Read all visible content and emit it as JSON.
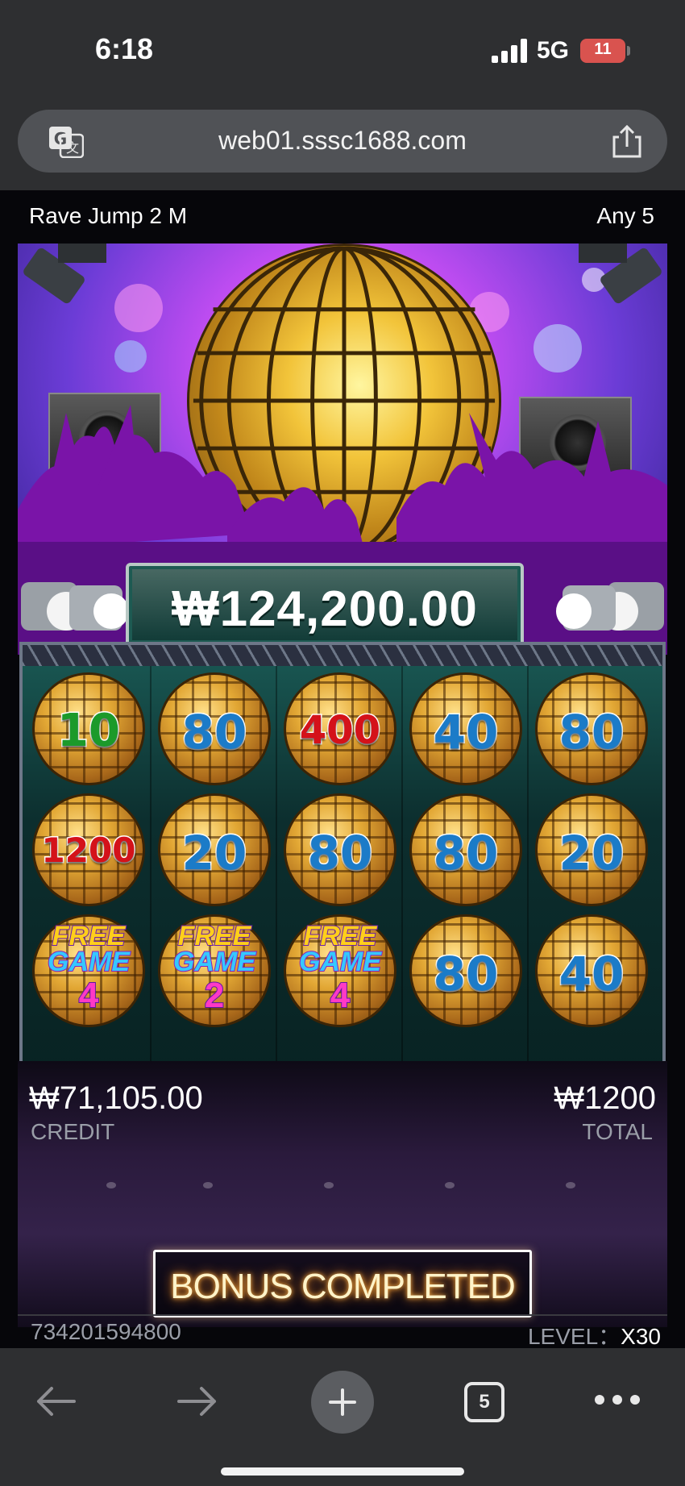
{
  "status_bar": {
    "time": "6:18",
    "network": "5G",
    "battery": "11"
  },
  "browser": {
    "url": "web01.sssc1688.com",
    "tab_count": "5",
    "icons": [
      "translate-icon",
      "share-icon",
      "back-arrow-icon",
      "forward-arrow-icon",
      "new-tab-plus-icon",
      "tabs-icon",
      "more-dots-icon"
    ]
  },
  "game": {
    "title": "Rave Jump 2 M",
    "lines": "Any 5",
    "jackpot": "₩124,200.00",
    "credit_value": "₩71,105.00",
    "credit_label": "CREDIT",
    "total_value": "₩1200",
    "total_label": "TOTAL",
    "bonus_label": "BONUS COMPLETED",
    "round_id": "734201594800",
    "level_label": "LEVEL：",
    "level_value": "X30",
    "reels": [
      [
        {
          "type": "number",
          "value": "10",
          "color": "#1b9a2a"
        },
        {
          "type": "number",
          "value": "1200",
          "color": "#d4121a"
        },
        {
          "type": "free",
          "top": "FREE",
          "mid": "GAME",
          "num": "4"
        }
      ],
      [
        {
          "type": "number",
          "value": "80",
          "color": "#1b7bc8"
        },
        {
          "type": "number",
          "value": "20",
          "color": "#1b7bc8"
        },
        {
          "type": "free",
          "top": "FREE",
          "mid": "GAME",
          "num": "2"
        }
      ],
      [
        {
          "type": "number",
          "value": "400",
          "color": "#d4121a"
        },
        {
          "type": "number",
          "value": "80",
          "color": "#1b7bc8"
        },
        {
          "type": "free",
          "top": "FREE",
          "mid": "GAME",
          "num": "4"
        }
      ],
      [
        {
          "type": "number",
          "value": "40",
          "color": "#1b7bc8"
        },
        {
          "type": "number",
          "value": "80",
          "color": "#1b7bc8"
        },
        {
          "type": "number",
          "value": "80",
          "color": "#1b7bc8"
        }
      ],
      [
        {
          "type": "number",
          "value": "80",
          "color": "#1b7bc8"
        },
        {
          "type": "number",
          "value": "20",
          "color": "#1b7bc8"
        },
        {
          "type": "number",
          "value": "40",
          "color": "#1b7bc8"
        }
      ]
    ]
  },
  "colors": {
    "browser_chrome": "#2e2f31",
    "url_pill": "#505256",
    "jackpot_panel": "#0f3a36",
    "battery_low": "#d9534f"
  }
}
